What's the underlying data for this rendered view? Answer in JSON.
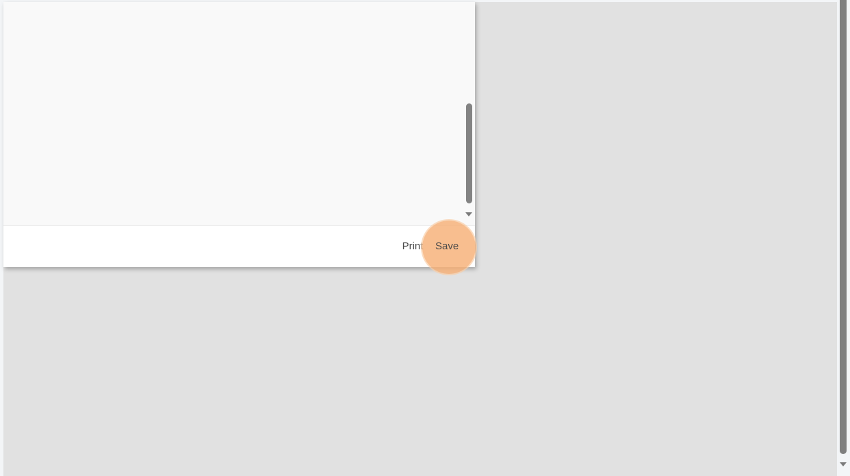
{
  "dialog": {
    "footer": {
      "print_label": "Print",
      "save_label": "Save"
    }
  },
  "colors": {
    "backdrop": "#e1e1e1",
    "dialog_content": "#f9f9f9",
    "dialog_footer": "#ffffff",
    "click_highlight": "#f7b076",
    "scrollbar_thumb": "#838383",
    "button_text": "#4a4a4a"
  },
  "icons": {
    "dialog_scroll_down": "triangle-down",
    "page_scroll_down": "triangle-down"
  }
}
